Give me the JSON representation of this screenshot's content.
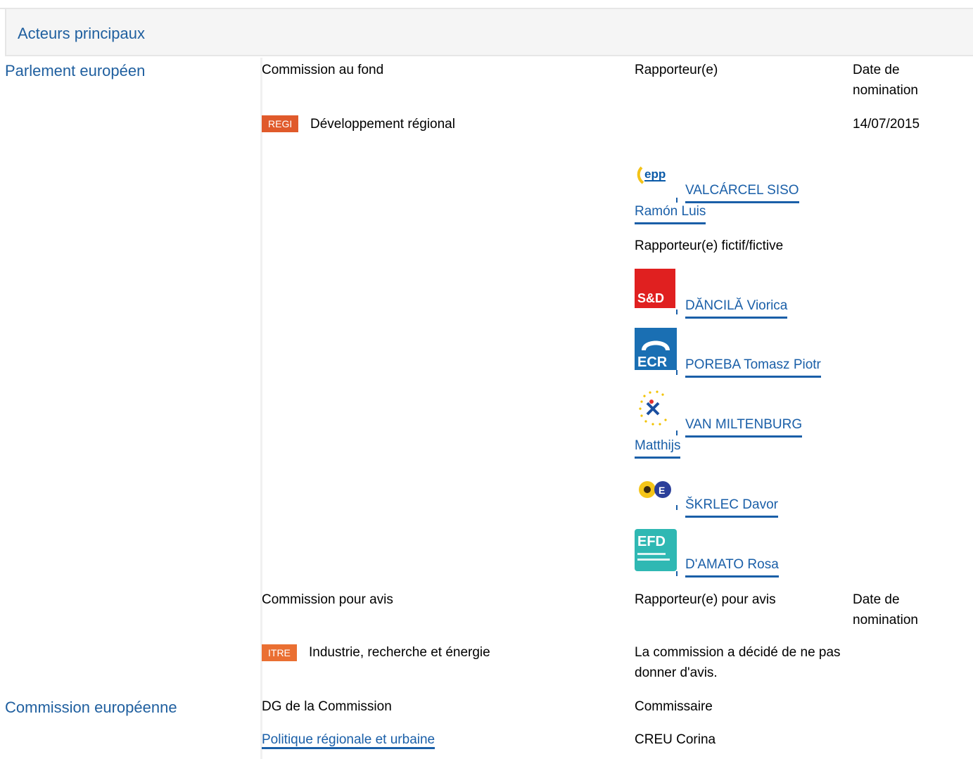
{
  "section": {
    "title": "Acteurs principaux"
  },
  "parliament": {
    "label": "Parlement européen",
    "lead_committee": {
      "header_commission": "Commission au fond",
      "header_rapporteur": "Rapporteur(e)",
      "header_date": "Date de nomination",
      "committee_code": "REGI",
      "committee_name": "Développement régional",
      "date": "14/07/2015",
      "rapporteur": {
        "name_line1": "VALCÁRCEL SISO",
        "name_line2": "Ramón Luis",
        "group_logo": "epp-logo"
      },
      "shadow_label": "Rapporteur(e) fictif/fictive",
      "shadows": [
        {
          "name": "DĂNCILĂ Viorica",
          "group_logo": "sd-logo"
        },
        {
          "name": "POREBA Tomasz Piotr",
          "group_logo": "ecr-logo"
        },
        {
          "name_line1": "VAN MILTENBURG",
          "name_line2": "Matthijs",
          "group_logo": "alde-logo"
        },
        {
          "name": "ŠKRLEC Davor",
          "group_logo": "greens-efa-logo"
        },
        {
          "name": "D'AMATO Rosa",
          "group_logo": "efd-logo"
        }
      ]
    },
    "opinion_committee": {
      "header_commission": "Commission pour avis",
      "header_rapporteur": "Rapporteur(e) pour avis",
      "header_date": "Date de nomination",
      "committee_code": "ITRE",
      "committee_name": "Industrie, recherche et énergie",
      "decision": "La commission a décidé de ne pas donner d'avis."
    }
  },
  "commission": {
    "label": "Commission européenne",
    "header_dg": "DG de la Commission",
    "header_commissioner": "Commissaire",
    "dg": "Politique régionale et urbaine",
    "commissioner": "CREU Corina"
  },
  "colors": {
    "link": "#1a5fa8",
    "title": "#1f5f9f",
    "regi_badge": "#e05a2b",
    "itre_badge": "#ea6f32"
  }
}
